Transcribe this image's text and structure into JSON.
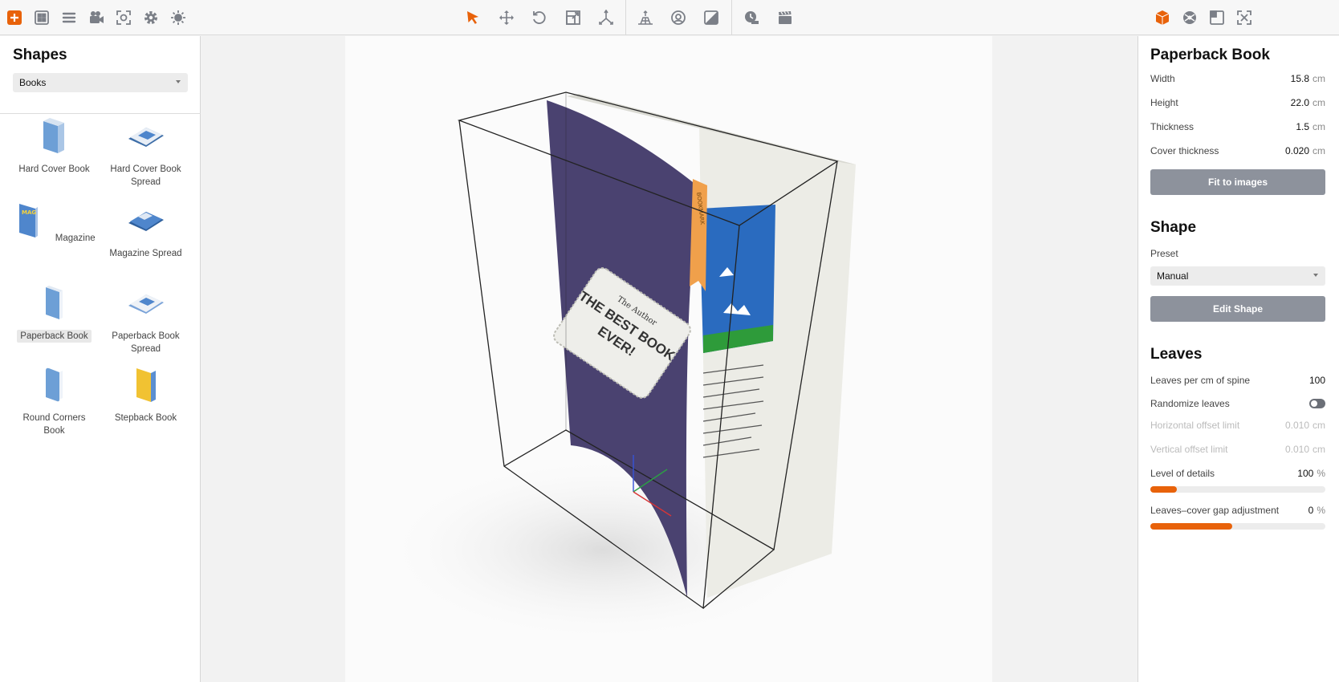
{
  "colors": {
    "accent": "#e8620a",
    "icon": "#7b7f87",
    "button": "#8d929c"
  },
  "toolbar": {
    "left_icons": [
      "add-shape-icon",
      "grid-icon",
      "layers-icon",
      "camera-icon",
      "focus-icon",
      "gear-icon",
      "light-icon"
    ],
    "center_icons": [
      "select-icon",
      "move-icon",
      "rotate-icon",
      "scale-icon",
      "axis-icon",
      "floor-icon",
      "material-icon",
      "texture-icon",
      "render-icon",
      "clapperboard-icon"
    ],
    "right_icons": [
      "object-icon",
      "sphere-icon",
      "layout-icon",
      "fullscreen-icon"
    ]
  },
  "left_panel": {
    "title": "Shapes",
    "category": "Books",
    "items": [
      {
        "label": "Hard Cover Book",
        "icon": "hard-cover-book-icon"
      },
      {
        "label": "Hard Cover Book Spread",
        "icon": "hard-cover-book-spread-icon"
      },
      {
        "label": "Magazine",
        "icon": "magazine-icon",
        "badge": "MAG"
      },
      {
        "label": "Magazine Spread",
        "icon": "magazine-spread-icon"
      },
      {
        "label": "Paperback Book",
        "icon": "paperback-book-icon",
        "selected": true
      },
      {
        "label": "Paperback Book Spread",
        "icon": "paperback-book-spread-icon"
      },
      {
        "label": "Round Corners Book",
        "icon": "round-corners-book-icon"
      },
      {
        "label": "Stepback Book",
        "icon": "stepback-book-icon"
      }
    ]
  },
  "viewport": {
    "cover_author": "The Author",
    "cover_title_line1": "THE BEST BOOK",
    "cover_title_line2": "EVER!",
    "bookmark_text": "BOOKMARK"
  },
  "right_panel": {
    "title": "Paperback Book",
    "dimensions": [
      {
        "label": "Width",
        "value": "15.8",
        "unit": "cm"
      },
      {
        "label": "Height",
        "value": "22.0",
        "unit": "cm"
      },
      {
        "label": "Thickness",
        "value": "1.5",
        "unit": "cm"
      },
      {
        "label": "Cover thickness",
        "value": "0.020",
        "unit": "cm"
      }
    ],
    "fit_button": "Fit to images",
    "shape_title": "Shape",
    "preset_label": "Preset",
    "preset_value": "Manual",
    "edit_shape_button": "Edit Shape",
    "leaves_title": "Leaves",
    "leaves_per_cm_label": "Leaves per cm of spine",
    "leaves_per_cm_value": "100",
    "randomize_label": "Randomize leaves",
    "randomize_on": false,
    "h_offset_label": "Horizontal offset limit",
    "h_offset_value": "0.010",
    "h_offset_unit": "cm",
    "v_offset_label": "Vertical offset limit",
    "v_offset_value": "0.010",
    "v_offset_unit": "cm",
    "lod_label": "Level of details",
    "lod_value": "100",
    "lod_unit": "%",
    "lod_fraction": 0.15,
    "gap_label": "Leaves–cover gap adjustment",
    "gap_value": "0",
    "gap_unit": "%",
    "gap_fraction": 0.47
  }
}
